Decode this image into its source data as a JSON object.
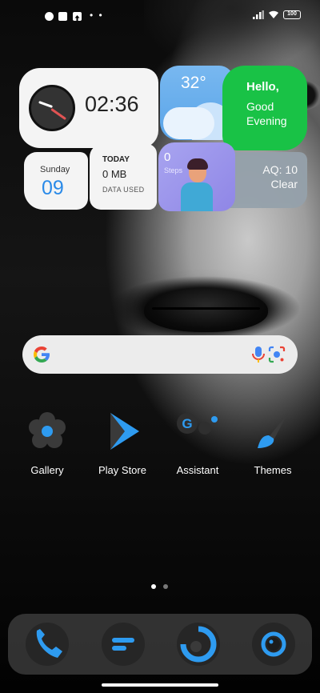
{
  "status_bar": {
    "icons": [
      "app-notification-icon",
      "square-notification-icon",
      "upload-notification-icon"
    ],
    "dots": "• •",
    "battery": "100"
  },
  "widgets": {
    "clock": {
      "time": "02:36"
    },
    "weather": {
      "temperature": "32°"
    },
    "greeting": {
      "title": "Hello,",
      "subtitle": "Good\nEvening"
    },
    "date": {
      "day": "Sunday",
      "date": "09"
    },
    "data_usage": {
      "label": "TODAY",
      "value": "0 MB",
      "caption": "DATA USED"
    },
    "steps": {
      "count": "0",
      "label": "Steps"
    },
    "air_quality": {
      "title": "AQ: 10",
      "status": "Clear"
    }
  },
  "search": {
    "icons": [
      "google-icon",
      "mic-icon",
      "lens-icon"
    ]
  },
  "apps": [
    {
      "label": "Gallery",
      "icon": "gallery-icon"
    },
    {
      "label": "Play Store",
      "icon": "play-store-icon"
    },
    {
      "label": "Assistant",
      "icon": "assistant-icon"
    },
    {
      "label": "Themes",
      "icon": "themes-icon"
    }
  ],
  "page_indicator": {
    "current": 1,
    "total": 2
  },
  "dock": [
    {
      "icon": "phone-icon"
    },
    {
      "icon": "messages-icon"
    },
    {
      "icon": "browser-icon"
    },
    {
      "icon": "camera-icon"
    }
  ],
  "colors": {
    "accent": "#2a8ae8",
    "greeting_green": "#19c246",
    "weather_blue": "#5aa4e8"
  }
}
